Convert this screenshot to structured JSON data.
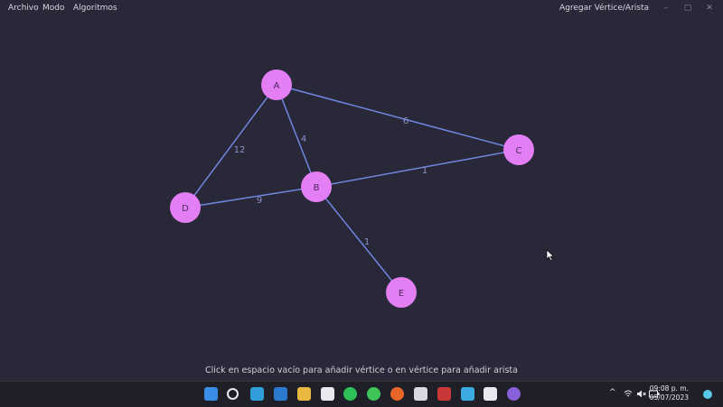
{
  "menu": {
    "archivo": "Archivo",
    "modo": "Modo",
    "algoritmos": "Algoritmos"
  },
  "window": {
    "mode_label": "Agregar Vértice/Arista",
    "minimize": "–",
    "maximize": "▢",
    "close": "✕"
  },
  "graph": {
    "vertex_color": "#e47ef5",
    "edge_color": "#6f86e0",
    "weight_color": "#8a92c8",
    "vertices": [
      "A",
      "B",
      "C",
      "D",
      "E"
    ],
    "edges": [
      {
        "from": "A",
        "to": "C",
        "weight": "6"
      },
      {
        "from": "A",
        "to": "B",
        "weight": "4"
      },
      {
        "from": "A",
        "to": "D",
        "weight": "12"
      },
      {
        "from": "B",
        "to": "C",
        "weight": "1"
      },
      {
        "from": "D",
        "to": "B",
        "weight": "9"
      },
      {
        "from": "B",
        "to": "E",
        "weight": "1"
      }
    ]
  },
  "status": {
    "hint": "Click en espacio vacío para añadir vértice o en vértice para añadir arista"
  },
  "taskbar": {
    "apps": [
      "windows-start-icon",
      "search-icon",
      "edge-icon",
      "vscode-icon",
      "file-explorer-icon",
      "store-icon",
      "spotify-icon",
      "whatsapp-icon",
      "firefox-icon",
      "github-icon",
      "app-icon",
      "pycharm-icon",
      "photos-icon",
      "media-player-icon"
    ],
    "tray": {
      "chevron": "^",
      "clock_time": "09:08 p. m.",
      "clock_date": "05/07/2023"
    }
  }
}
